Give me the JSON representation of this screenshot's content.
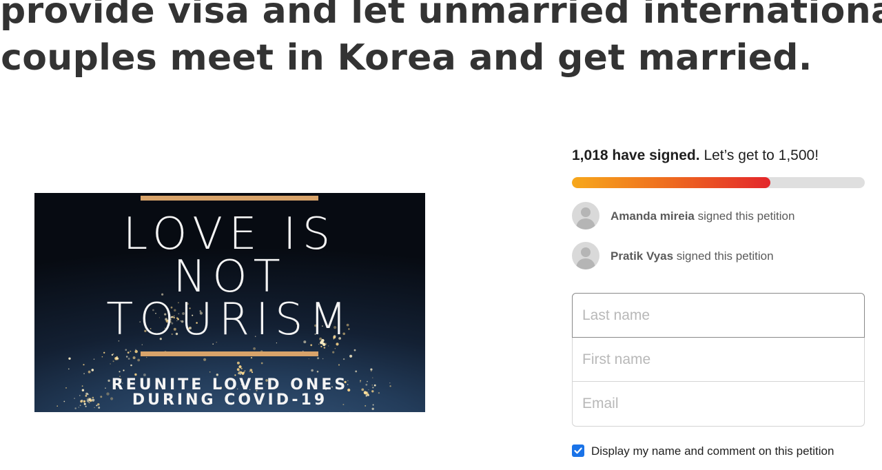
{
  "petition": {
    "title_line1": "provide visa and let unmarried international",
    "title_line2": "couples meet in Korea and get married."
  },
  "hero_image": {
    "line1": "LOVE IS",
    "line2": "NOT",
    "line3": "TOURISM",
    "subline1": "REUNITE LOVED ONES",
    "subline2": "DURING COVID-19",
    "accent_color": "#d8a36a"
  },
  "progress": {
    "signed_text": "1,018 have signed.",
    "goal_text": "Let’s get to 1,500!",
    "signed": 1018,
    "goal": 1500,
    "fill_colors": [
      "#f7a81b",
      "#ee6a1f",
      "#e3262b"
    ]
  },
  "recent_signers": [
    {
      "name": "Amanda mireia",
      "action": "signed this petition"
    },
    {
      "name": "Pratik Vyas",
      "action": "signed this petition"
    }
  ],
  "form": {
    "last_name_placeholder": "Last name",
    "first_name_placeholder": "First name",
    "email_placeholder": "Email",
    "display_consent_label": "Display my name and comment on this petition",
    "display_consent_checked": true
  },
  "icons": {
    "avatar": "person-silhouette-icon",
    "checkbox": "checkmark-icon"
  }
}
